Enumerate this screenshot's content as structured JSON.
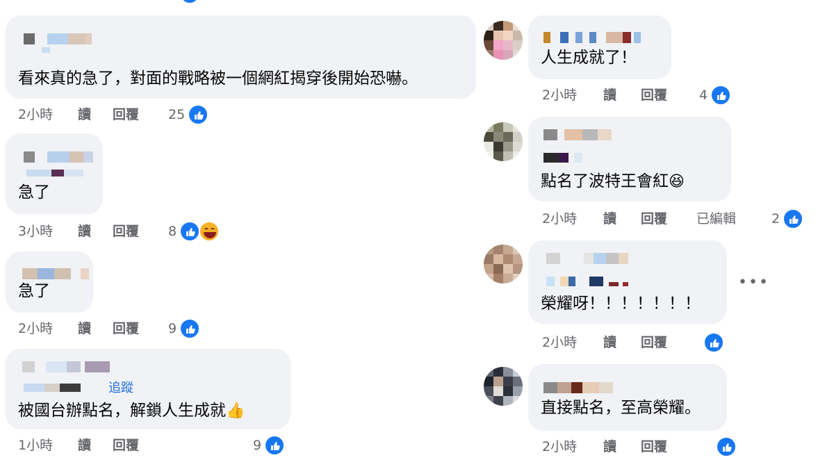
{
  "labels": {
    "read": "讀",
    "reply": "回覆",
    "edited": "已編輯",
    "follow": "追蹤",
    "more": "•••"
  },
  "colors": {
    "bubble": "#f0f2f5",
    "meta_text": "#65676b",
    "like_blue": "#1877f2",
    "link_blue": "#216fdb"
  },
  "left_comments": [
    {
      "text": "看來真的急了，對面的戰略被一個網紅揭穿後開始恐嚇。",
      "time": "2小時",
      "reactions": "25",
      "reaction_icons": [
        "like-icon"
      ]
    },
    {
      "text": "急了",
      "time": "3小時",
      "reactions": "8",
      "reaction_icons": [
        "like-icon",
        "haha-icon"
      ]
    },
    {
      "text": "急了",
      "time": "2小時",
      "reactions": "9",
      "reaction_icons": [
        "like-icon"
      ]
    },
    {
      "text": "被國台辦點名，解鎖人生成就",
      "emoji": "👍",
      "time": "1小時",
      "reactions": "9",
      "reaction_icons": [
        "like-icon"
      ]
    }
  ],
  "right_comments": [
    {
      "text": "人生成就了！",
      "time": "2小時",
      "reactions": "4",
      "reaction_icons": [
        "like-icon"
      ]
    },
    {
      "text": "點名了波特王會紅",
      "emoji": "😆",
      "time": "2小時",
      "edited": true,
      "reactions": "2",
      "reaction_icons": [
        "like-icon"
      ]
    },
    {
      "text": "榮耀呀！！！！！！！",
      "time": "2小時",
      "reactions": "",
      "reaction_icons": [
        "like-icon"
      ]
    },
    {
      "text": "直接點名，至高榮耀。",
      "time": "2小時",
      "reactions": "",
      "reaction_icons": [
        "like-icon"
      ]
    }
  ]
}
